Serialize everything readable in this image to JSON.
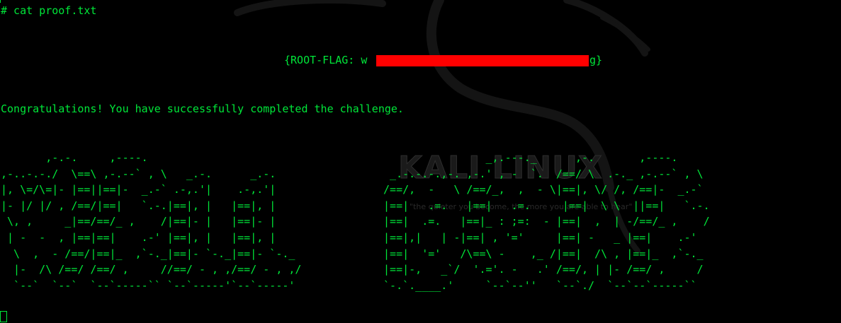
{
  "terminal": {
    "prompt_line": "# cat proof.txt",
    "flag_prefix": "{ROOT-FLAG: w",
    "flag_tail": "g}",
    "congrats": "Congratulations! You have successfully completed the challenge.",
    "ascii_left": "       ,-.-.     ,----.\n,-..-.-./  \\==\\ ,-.--` , \\   _.-.      _.-.\n|, \\=/\\=|- |==||==|-  _.-` .-,.'|    .-,.'|\n|- |/ |/ , /==/|==|   `.-.|==|, |   |==|, |\n \\, ,     _|==/==/_ ,    /|==|- |   |==|- |\n | -  -  , |==|==|    .-' |==|, |   |==|, |\n  \\  ,  - /==/|==|_  ,`-._|==|- `-._|==|- `-._\n  |-  /\\ /==/ /==/ ,     //==/ - , ,/==/ - , ,/\n  `--`  `--`  `--`-----`` `--`-----'`--`-----'",
    "ascii_right": "                 _,.---._      ,-.       ,----.\n  _.-.-.-.,-. ,-.' , -  `.  /==/ \\  .-._ ,-.--` , \\\n /==/,  -   \\ /==/_,  ,  - \\|==|, \\/ /, /==|-  _.-`\n |==|   .=.   |==|   .=.     |==|  \\ \\  ||==|   `.-.\n |==|  .=.   |==|_ : ;=:  - |==|  ,  | -/==/_ ,    /\n |==|,|   | -|==| , '='     |==| -   _ |==|    .-'\n |==|  '='   /\\==\\ -    ,_ /|==|  /\\ , |==|_  ,`-._\n |==|-,   _`/  '.='. -   .' /==/, | |- /==/ ,     /\n `-.`.____.'     `--`--''   `--`./  `--`--`-----``",
    "watermark": "KALI LINUX",
    "tagline": "\"the quieter you become, the more you are able to hear\""
  },
  "colors": {
    "foreground": "#00e639",
    "background": "#000000",
    "redaction": "#ff0000"
  }
}
